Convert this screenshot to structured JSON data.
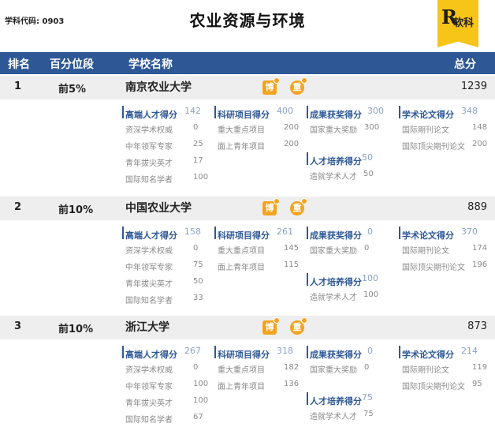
{
  "subject_code": "学科代码: 0903",
  "title": "农业资源与环境",
  "logo": {
    "letter": "R",
    "text": "软科",
    "color": "#f7c418"
  },
  "header": {
    "rank": "排名",
    "percentile": "百分位段",
    "school": "学校名称",
    "score": "总分"
  },
  "colors": {
    "header_bg": "#2e5895",
    "row_bg": "#eeeeee",
    "badge": "#f4a31f"
  },
  "badges": {
    "bo": "博",
    "zhong": "重"
  },
  "entries": [
    {
      "rank": "1",
      "percentile": "前5%",
      "school": "南京农业大学",
      "total": "1239",
      "talent": {
        "label": "高端人才得分",
        "score": "142",
        "items": [
          {
            "label": "资深学术权威",
            "value": "0"
          },
          {
            "label": "中年领军专家",
            "value": "25"
          },
          {
            "label": "青年拔尖英才",
            "value": "17"
          },
          {
            "label": "国际知名学者",
            "value": "100"
          }
        ]
      },
      "research": {
        "label": "科研项目得分",
        "score": "400",
        "items": [
          {
            "label": "重大重点项目",
            "value": "200"
          },
          {
            "label": "面上青年项目",
            "value": "200"
          }
        ]
      },
      "award": {
        "label": "成果获奖得分",
        "score": "300",
        "items": [
          {
            "label": "国家重大奖励",
            "value": "300"
          }
        ]
      },
      "training": {
        "label": "人才培养得分",
        "score": "50",
        "items": [
          {
            "label": "造就学术人才",
            "value": "50"
          }
        ]
      },
      "paper": {
        "label": "学术论文得分",
        "score": "348",
        "items": [
          {
            "label": "国际期刊论文",
            "value": "148"
          },
          {
            "label": "国际顶尖期刊论文",
            "value": "200"
          }
        ]
      }
    },
    {
      "rank": "2",
      "percentile": "前10%",
      "school": "中国农业大学",
      "total": "889",
      "talent": {
        "label": "高端人才得分",
        "score": "158",
        "items": [
          {
            "label": "资深学术权威",
            "value": "0"
          },
          {
            "label": "中年领军专家",
            "value": "75"
          },
          {
            "label": "青年拔尖英才",
            "value": "50"
          },
          {
            "label": "国际知名学者",
            "value": "33"
          }
        ]
      },
      "research": {
        "label": "科研项目得分",
        "score": "261",
        "items": [
          {
            "label": "重大重点项目",
            "value": "145"
          },
          {
            "label": "面上青年项目",
            "value": "115"
          }
        ]
      },
      "award": {
        "label": "成果获奖得分",
        "score": "0",
        "items": [
          {
            "label": "国家重大奖励",
            "value": "0"
          }
        ]
      },
      "training": {
        "label": "人才培养得分",
        "score": "100",
        "items": [
          {
            "label": "造就学术人才",
            "value": "100"
          }
        ]
      },
      "paper": {
        "label": "学术论文得分",
        "score": "370",
        "items": [
          {
            "label": "国际期刊论文",
            "value": "174"
          },
          {
            "label": "国际顶尖期刊论文",
            "value": "196"
          }
        ]
      }
    },
    {
      "rank": "3",
      "percentile": "前10%",
      "school": "浙江大学",
      "total": "873",
      "talent": {
        "label": "高端人才得分",
        "score": "267",
        "items": [
          {
            "label": "资深学术权威",
            "value": "0"
          },
          {
            "label": "中年领军专家",
            "value": "100"
          },
          {
            "label": "青年拔尖英才",
            "value": "100"
          },
          {
            "label": "国际知名学者",
            "value": "67"
          }
        ]
      },
      "research": {
        "label": "科研项目得分",
        "score": "318",
        "items": [
          {
            "label": "重大重点项目",
            "value": "182"
          },
          {
            "label": "面上青年项目",
            "value": "136"
          }
        ]
      },
      "award": {
        "label": "成果获奖得分",
        "score": "0",
        "items": [
          {
            "label": "国家重大奖励",
            "value": "0"
          }
        ]
      },
      "training": {
        "label": "人才培养得分",
        "score": "75",
        "items": [
          {
            "label": "造就学术人才",
            "value": "75"
          }
        ]
      },
      "paper": {
        "label": "学术论文得分",
        "score": "214",
        "items": [
          {
            "label": "国际期刊论文",
            "value": "119"
          },
          {
            "label": "国际顶尖期刊论文",
            "value": "95"
          }
        ]
      }
    }
  ]
}
